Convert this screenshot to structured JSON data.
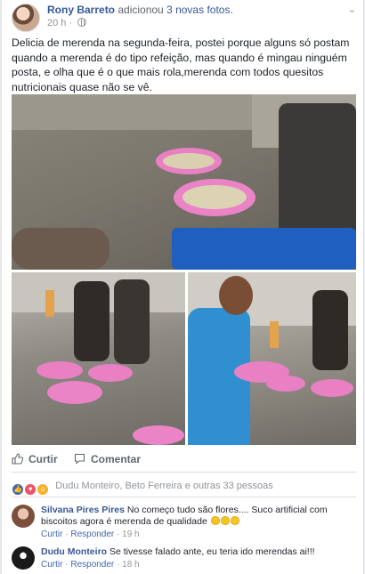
{
  "post": {
    "author": "Rony Barreto",
    "action_prefix": "adicionou",
    "action_link": "3 novas fotos.",
    "time": "20 h",
    "time_sep": "·",
    "text": "Delicia de merenda na segunda-feira, postei porque alguns só postam quando a merenda é do tipo refeição, mas quando é mingau ninguém posta, e olha que é o que mais rola,merenda com todos quesitos nutricionais quase não se vê."
  },
  "actions": {
    "like_label": "Curtir",
    "comment_label": "Comentar"
  },
  "reactions": {
    "summary": "Dudu Monteiro, Beto Ferreira e outras 33 pessoas",
    "types": [
      "like",
      "love",
      "wow"
    ]
  },
  "comments": [
    {
      "name": "Silvana Pires Pires",
      "text": "No começo tudo são flores.... Suco artificial com biscoitos agora é merenda de qualidade",
      "emoji_count": 3,
      "like": "Curtir",
      "reply": "Responder",
      "time": "19 h"
    },
    {
      "name": "Dudu Monteiro",
      "text": "Se tivesse falado ante, eu teria ido merendas ai!!!",
      "emoji_count": 0,
      "like": "Curtir",
      "reply": "Responder",
      "time": "18 h"
    }
  ],
  "colors": {
    "link": "#365899",
    "meta": "#90949c",
    "plate_pink": "#e88cc8"
  }
}
